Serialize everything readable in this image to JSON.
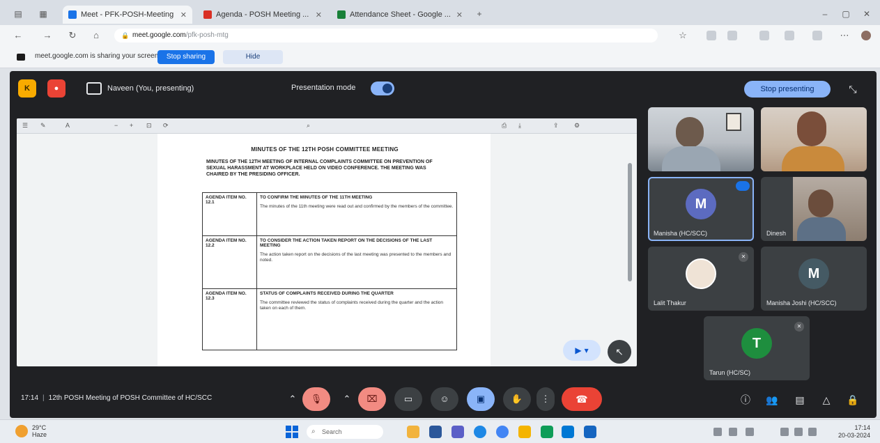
{
  "browser": {
    "tabs": [
      {
        "label": "Meet - PFK-POSH-Meeting",
        "active": true,
        "favicon_color": "#1a73e8"
      },
      {
        "label": "Agenda - POSH Meeting ...",
        "active": false,
        "favicon_color": "#d93025"
      },
      {
        "label": "Attendance Sheet - Google ...",
        "active": false,
        "favicon_color": "#188038"
      }
    ],
    "url_host": "meet.google.com",
    "url_path": "/pfk-posh-mtg",
    "share_message": "meet.google.com is sharing your screen.",
    "stop_sharing_label": "Stop sharing",
    "hide_label": "Hide"
  },
  "meet": {
    "presenting_text": "Naveen (You, presenting)",
    "presentation_mode_label": "Presentation mode",
    "stop_presenting_label": "Stop presenting",
    "meeting_time": "17:14",
    "meeting_title": "12th POSH Meeting of POSH Committee of HC/SCC",
    "colors": {
      "accent": "#8ab4f8",
      "end_call": "#ea4335",
      "bg": "#202124"
    }
  },
  "document": {
    "heading": "MINUTES OF THE 12TH POSH COMMITTEE MEETING",
    "intro": "MINUTES OF THE 12TH MEETING OF INTERNAL COMPLAINTS COMMITTEE ON PREVENTION OF SEXUAL HARASSMENT AT WORKPLACE HELD ON VIDEO CONFERENCE. THE MEETING WAS CHAIRED BY THE PRESIDING OFFICER.",
    "agenda": [
      {
        "number": "AGENDA ITEM NO. 12.1",
        "title": "TO CONFIRM THE MINUTES OF THE 11TH MEETING",
        "desc": "The minutes of the 11th meeting were read out and confirmed by the members of the committee."
      },
      {
        "number": "AGENDA ITEM NO. 12.2",
        "title": "TO CONSIDER THE ACTION TAKEN REPORT ON THE DECISIONS OF THE LAST MEETING",
        "desc": "The action taken report on the decisions of the last meeting was presented to the members and noted."
      },
      {
        "number": "AGENDA ITEM NO. 12.3",
        "title": "STATUS OF COMPLAINTS RECEIVED DURING THE QUARTER",
        "desc": "The committee reviewed the status of complaints received during the quarter and the action taken on each of them."
      }
    ]
  },
  "participants": [
    {
      "name": "",
      "initial": "",
      "type": "camera"
    },
    {
      "name": "",
      "initial": "",
      "type": "camera"
    },
    {
      "name": "Manisha (HC/SCC)",
      "initial": "M",
      "type": "avatar",
      "color": "#5c6bc0",
      "speaking": true
    },
    {
      "name": "Dinesh",
      "initial": "",
      "type": "camera"
    },
    {
      "name": "Lalit Thakur",
      "initial": "",
      "type": "photo"
    },
    {
      "name": "Manisha Joshi (HC/SCC)",
      "initial": "M",
      "type": "avatar",
      "color": "#455a64"
    },
    {
      "name": "Tarun (HC/SC)",
      "initial": "T",
      "type": "avatar",
      "color": "#1e8e3e"
    }
  ],
  "taskbar": {
    "weather_temp": "29°C",
    "weather_desc": "Haze",
    "search_placeholder": "Search",
    "time": "17:14",
    "date": "20-03-2024"
  }
}
